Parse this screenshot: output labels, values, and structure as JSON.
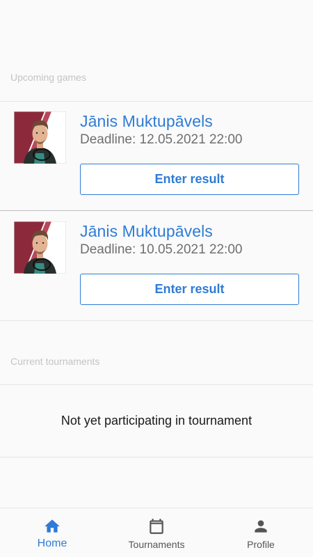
{
  "upcoming": {
    "header": "Upcoming games",
    "games": [
      {
        "player_name": "Jānis Muktupāvels",
        "deadline": "Deadline: 12.05.2021 22:00",
        "button_label": "Enter result"
      },
      {
        "player_name": "Jānis Muktupāvels",
        "deadline": "Deadline: 10.05.2021 22:00",
        "button_label": "Enter result"
      }
    ]
  },
  "tournaments": {
    "header": "Current tournaments",
    "empty_message": "Not yet participating in tournament"
  },
  "nav": {
    "items": [
      {
        "label": "Home",
        "icon": "home-icon",
        "active": true
      },
      {
        "label": "Tournaments",
        "icon": "calendar-icon",
        "active": false
      },
      {
        "label": "Profile",
        "icon": "person-icon",
        "active": false
      }
    ]
  },
  "colors": {
    "accent": "#2f7bd6",
    "background": "#fafafa",
    "muted_text": "#c4c4c4",
    "nav_inactive": "#555555"
  }
}
